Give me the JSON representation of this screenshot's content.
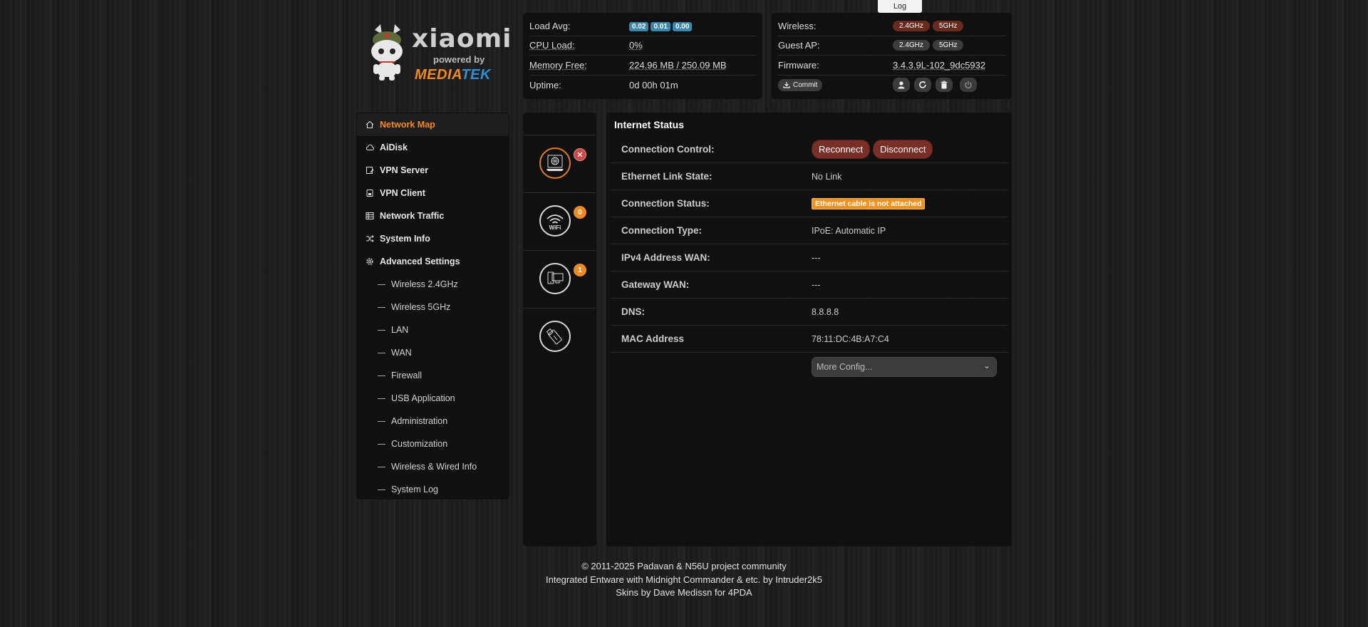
{
  "log_tab": "Log",
  "logo": {
    "brand": "xiaomi",
    "powered": "powered by",
    "vendor_a": "MEDIA",
    "vendor_b": "TEK"
  },
  "stats": {
    "load_avg_label": "Load Avg:",
    "load_avg": [
      "0.02",
      "0.01",
      "0.00"
    ],
    "cpu_label": "CPU Load:",
    "cpu_value": "0%",
    "mem_label": "Memory Free:",
    "mem_value": "224.96 MB / 250.09 MB",
    "uptime_label": "Uptime:",
    "uptime_value": "0d 00h 01m"
  },
  "system": {
    "wireless_label": "Wireless:",
    "wireless_24": "2.4GHz",
    "wireless_5": "5GHz",
    "guest_label": "Guest AP:",
    "guest_24": "2.4GHz",
    "guest_5": "5GHz",
    "firmware_label": "Firmware:",
    "firmware_value": "3.4.3.9L-102_9dc5932",
    "commit_label": "Commit"
  },
  "sidebar": {
    "items": [
      {
        "label": "Network Map",
        "icon": "home-icon"
      },
      {
        "label": "AiDisk",
        "icon": "cloud-icon"
      },
      {
        "label": "VPN Server",
        "icon": "vpn-server-icon"
      },
      {
        "label": "VPN Client",
        "icon": "vpn-client-icon"
      },
      {
        "label": "Network Traffic",
        "icon": "traffic-icon"
      },
      {
        "label": "System Info",
        "icon": "shuffle-icon"
      },
      {
        "label": "Advanced Settings",
        "icon": "gear-icon"
      }
    ],
    "sub_items": [
      "Wireless 2.4GHz",
      "Wireless 5GHz",
      "LAN",
      "WAN",
      "Firewall",
      "USB Application",
      "Administration",
      "Customization",
      "Wireless & Wired Info",
      "System Log"
    ]
  },
  "mid": {
    "wifi_text": "WiFi",
    "wifi_badge": "0",
    "clients_badge": "1"
  },
  "main": {
    "title": "Internet Status",
    "rows": [
      {
        "label": "Connection Control:"
      },
      {
        "label": "Ethernet Link State:",
        "value": "No Link"
      },
      {
        "label": "Connection Status:",
        "value": "Ethernet cable is not attached"
      },
      {
        "label": "Connection Type:",
        "value": "IPoE: Automatic IP"
      },
      {
        "label": "IPv4 Address WAN:",
        "value": "---"
      },
      {
        "label": "Gateway WAN:",
        "value": "---"
      },
      {
        "label": "DNS:",
        "value": "8.8.8.8"
      },
      {
        "label": "MAC Address",
        "value": "78:11:DC:4B:A7:C4"
      }
    ],
    "reconnect_label": "Reconnect",
    "disconnect_label": "Disconnect",
    "more_config": "More Config..."
  },
  "colors": {
    "accent_orange": "#f08a24",
    "badge_blue": "#3a87ad",
    "button_red": "#7a2e28",
    "warning_orange": "#f0921e"
  },
  "footer": {
    "line1": "© 2011-2025 Padavan & N56U project community",
    "line2": "Integrated Entware with Midnight Commander & etc. by Intruder2k5",
    "line3": "Skins by Dave Medissn for 4PDA"
  }
}
